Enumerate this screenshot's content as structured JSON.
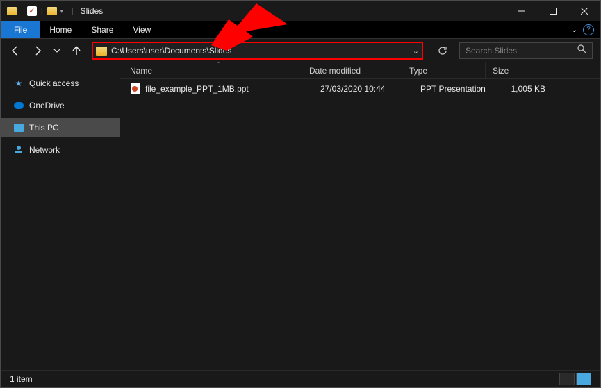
{
  "window": {
    "title": "Slides"
  },
  "ribbon": {
    "file": "File",
    "home": "Home",
    "share": "Share",
    "view": "View"
  },
  "address": {
    "path": "C:\\Users\\user\\Documents\\Slides"
  },
  "search": {
    "placeholder": "Search Slides"
  },
  "sidebar": {
    "items": [
      {
        "label": "Quick access",
        "icon": "star"
      },
      {
        "label": "OneDrive",
        "icon": "onedrive"
      },
      {
        "label": "This PC",
        "icon": "pc",
        "selected": true
      },
      {
        "label": "Network",
        "icon": "network"
      }
    ]
  },
  "columns": {
    "name": "Name",
    "date": "Date modified",
    "type": "Type",
    "size": "Size"
  },
  "files": [
    {
      "name": "file_example_PPT_1MB.ppt",
      "date": "27/03/2020 10:44",
      "type": "PPT Presentation",
      "size": "1,005 KB"
    }
  ],
  "status": {
    "count": "1 item"
  },
  "annotation": {
    "highlight_color": "#ff0000"
  }
}
